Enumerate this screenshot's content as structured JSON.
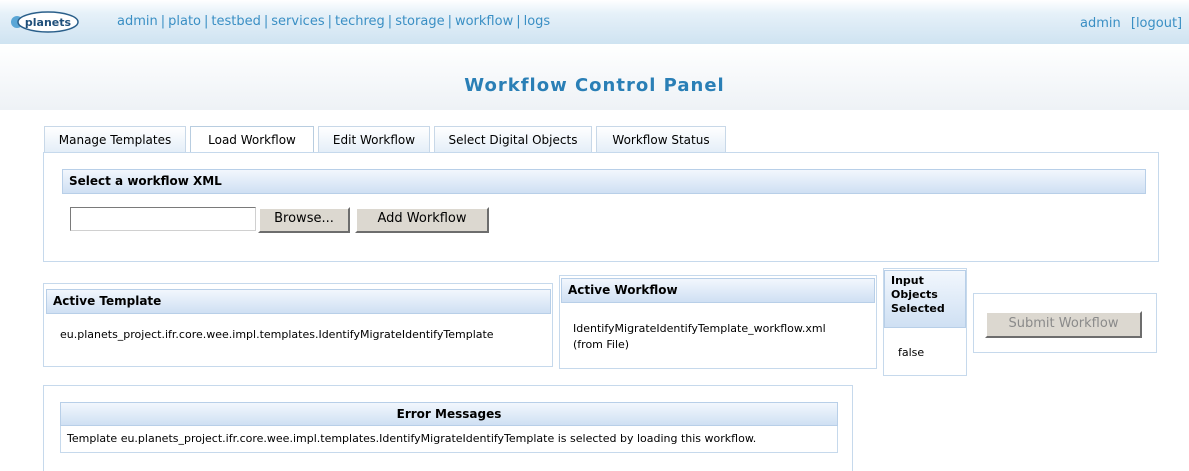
{
  "brand": {
    "logo_text": "planets"
  },
  "nav": {
    "items": [
      "admin",
      "plato",
      "testbed",
      "services",
      "techreg",
      "storage",
      "workflow",
      "logs"
    ]
  },
  "user": {
    "name": "admin",
    "logout_label": "[logout]"
  },
  "page": {
    "title": "Workflow Control Panel"
  },
  "tabs": [
    {
      "label": "Manage Templates"
    },
    {
      "label": "Load Workflow"
    },
    {
      "label": "Edit Workflow"
    },
    {
      "label": "Select Digital Objects"
    },
    {
      "label": "Workflow Status"
    }
  ],
  "active_tab": "Load Workflow",
  "load_section": {
    "title": "Select a workflow XML",
    "file_value": "",
    "browse_label": "Browse...",
    "add_label": "Add Workflow"
  },
  "active_template": {
    "title": "Active Template",
    "value": "eu.planets_project.ifr.core.wee.impl.templates.IdentifyMigrateIdentifyTemplate"
  },
  "active_workflow": {
    "title": "Active Workflow",
    "value_line1": "IdentifyMigrateIdentifyTemplate_workflow.xml",
    "value_line2": "(from File)"
  },
  "input_objects": {
    "title_line1": "Input",
    "title_line2": "Objects",
    "title_line3": "Selected",
    "value": "false"
  },
  "submit": {
    "label": "Submit Workflow",
    "enabled": false
  },
  "errors": {
    "title": "Error Messages",
    "message": "Template eu.planets_project.ifr.core.wee.impl.templates.IdentifyMigrateIdentifyTemplate is selected by loading this workflow."
  },
  "colors": {
    "link": "#3a8fc4",
    "title": "#2a7fb6",
    "header_bar": "#cfe3f1",
    "section_head": "#cfe0f3"
  }
}
